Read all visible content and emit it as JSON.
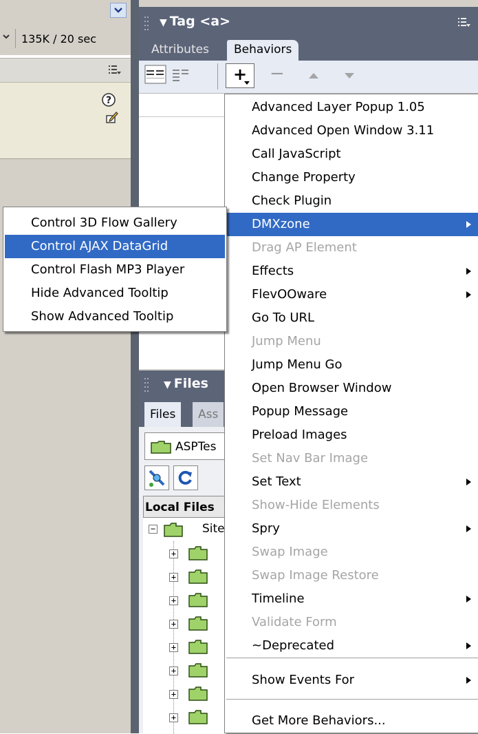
{
  "left_panel": {
    "connection_speed": "135K / 20 sec",
    "icons": [
      "chevron-down-icon",
      "help-icon",
      "edit-icon",
      "panel-options-icon"
    ]
  },
  "tag_panel": {
    "title": "Tag <a>",
    "tabs": [
      {
        "label": "Attributes"
      },
      {
        "label": "Behaviors"
      }
    ],
    "toolbar": {
      "add_label": "+",
      "remove_label": "−"
    }
  },
  "files_panel": {
    "title": "Files",
    "tabs": [
      {
        "label": "Files"
      },
      {
        "label": "Ass"
      }
    ],
    "site_select": "ASPTes",
    "local_files_header": "Local Files",
    "root_label": "Site"
  },
  "behaviors_menu": {
    "items": [
      {
        "label": "Advanced Layer Popup 1.05",
        "enabled": true,
        "submenu": false,
        "selected": false
      },
      {
        "label": "Advanced Open Window 3.11",
        "enabled": true,
        "submenu": false,
        "selected": false
      },
      {
        "label": "Call JavaScript",
        "enabled": true,
        "submenu": false,
        "selected": false
      },
      {
        "label": "Change Property",
        "enabled": true,
        "submenu": false,
        "selected": false
      },
      {
        "label": "Check Plugin",
        "enabled": true,
        "submenu": false,
        "selected": false
      },
      {
        "label": "DMXzone",
        "enabled": true,
        "submenu": true,
        "selected": true
      },
      {
        "label": "Drag AP Element",
        "enabled": false,
        "submenu": false,
        "selected": false
      },
      {
        "label": "Effects",
        "enabled": true,
        "submenu": true,
        "selected": false
      },
      {
        "label": "FlevOOware",
        "enabled": true,
        "submenu": true,
        "selected": false
      },
      {
        "label": "Go To URL",
        "enabled": true,
        "submenu": false,
        "selected": false
      },
      {
        "label": "Jump Menu",
        "enabled": false,
        "submenu": false,
        "selected": false
      },
      {
        "label": "Jump Menu Go",
        "enabled": true,
        "submenu": false,
        "selected": false
      },
      {
        "label": "Open Browser Window",
        "enabled": true,
        "submenu": false,
        "selected": false
      },
      {
        "label": "Popup Message",
        "enabled": true,
        "submenu": false,
        "selected": false
      },
      {
        "label": "Preload Images",
        "enabled": true,
        "submenu": false,
        "selected": false
      },
      {
        "label": "Set Nav Bar Image",
        "enabled": false,
        "submenu": false,
        "selected": false
      },
      {
        "label": "Set Text",
        "enabled": true,
        "submenu": true,
        "selected": false
      },
      {
        "label": "Show-Hide Elements",
        "enabled": false,
        "submenu": false,
        "selected": false
      },
      {
        "label": "Spry",
        "enabled": true,
        "submenu": true,
        "selected": false
      },
      {
        "label": "Swap Image",
        "enabled": false,
        "submenu": false,
        "selected": false
      },
      {
        "label": "Swap Image Restore",
        "enabled": false,
        "submenu": false,
        "selected": false
      },
      {
        "label": "Timeline",
        "enabled": true,
        "submenu": true,
        "selected": false
      },
      {
        "label": "Validate Form",
        "enabled": false,
        "submenu": false,
        "selected": false
      },
      {
        "label": "~Deprecated",
        "enabled": true,
        "submenu": true,
        "selected": false
      }
    ],
    "show_events_for": "Show Events For",
    "get_more": "Get More Behaviors..."
  },
  "dmxzone_submenu": {
    "items": [
      {
        "label": "Control 3D Flow Gallery",
        "selected": false
      },
      {
        "label": "Control AJAX DataGrid",
        "selected": true
      },
      {
        "label": "Control Flash MP3 Player",
        "selected": false
      },
      {
        "label": "Hide Advanced Tooltip",
        "selected": false
      },
      {
        "label": "Show Advanced Tooltip",
        "selected": false
      }
    ]
  },
  "colors": {
    "menu_highlight": "#316ac5",
    "panel_header": "#5c6478",
    "disabled_text": "#a5a5a5"
  }
}
